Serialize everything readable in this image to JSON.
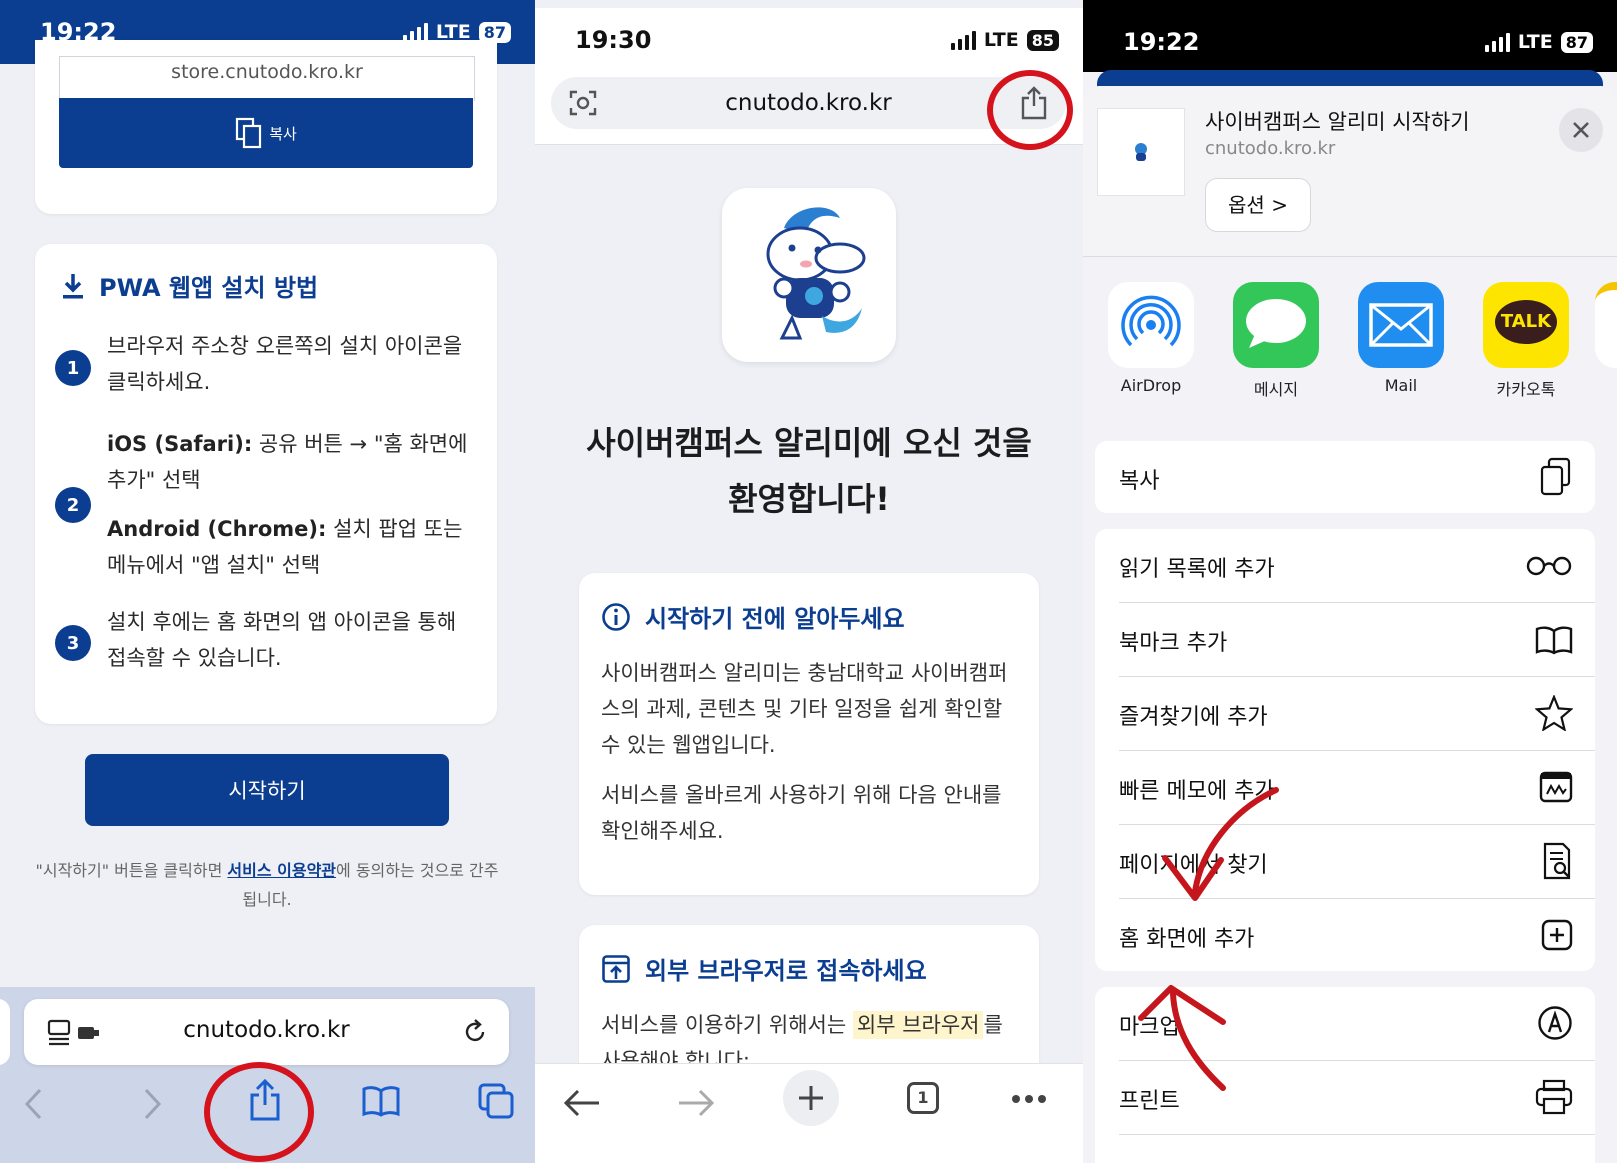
{
  "panel1": {
    "status": {
      "time": "19:22",
      "network": "LTE",
      "battery": "87"
    },
    "store_url": "store.cnutodo.kro.kr",
    "copy_label": "복사",
    "pwa_title": "PWA 웹앱 설치 방법",
    "steps": [
      {
        "num": "1",
        "text": "브라우저 주소창 오른쪽의 설치 아이콘을 클릭하세요."
      },
      {
        "num": "2",
        "ios_label": "iOS (Safari):",
        "ios_text": " 공유 버튼 → \"홈 화면에 추가\" 선택",
        "android_label": "Android (Chrome):",
        "android_text": " 설치 팝업 또는 메뉴에서 \"앱 설치\" 선택"
      },
      {
        "num": "3",
        "text": "설치 후에는 홈 화면의 앱 아이콘을 통해 접속할 수 있습니다."
      }
    ],
    "start_button": "시작하기",
    "terms_prefix": "\"시작하기\" 버튼을 클릭하면 ",
    "terms_link": "서비스 이용약관",
    "terms_suffix": "에 동의하는 것으로 간주됩니다.",
    "address": "cnutodo.kro.kr"
  },
  "panel2": {
    "status": {
      "time": "19:30",
      "network": "LTE",
      "battery": "85"
    },
    "address": "cnutodo.kro.kr",
    "welcome_line1": "사이버캠퍼스 알리미에 오신 것을",
    "welcome_line2": "환영합니다!",
    "notice_title": "시작하기 전에 알아두세요",
    "notice_p1": "사이버캠퍼스 알리미는 충남대학교 사이버캠퍼스의 과제, 콘텐츠 및 기타 일정을 쉽게 확인할 수 있는 웹앱입니다.",
    "notice_p2": "서비스를 올바르게 사용하기 위해 다음 안내를 확인해주세요.",
    "ext_title": "외부 브라우저로 접속하세요",
    "ext_text_prefix": "서비스를 이용하기 위해서는 ",
    "ext_highlight": "외부 브라우저",
    "ext_text_suffix": "를 사용해야 합니다:",
    "tab_count": "1"
  },
  "panel3": {
    "status": {
      "time": "19:22",
      "network": "LTE",
      "battery": "87"
    },
    "share_title": "사이버캠퍼스 알리미 시작하기",
    "share_url": "cnutodo.kro.kr",
    "options_label": "옵션 >",
    "apps": [
      {
        "label": "AirDrop",
        "icon": "airdrop-icon"
      },
      {
        "label": "메시지",
        "icon": "messages-icon"
      },
      {
        "label": "Mail",
        "icon": "mail-icon"
      },
      {
        "label": "카카오톡",
        "icon": "kakaotalk-icon"
      }
    ],
    "kakao_badge": "TALK",
    "copy_label": "복사",
    "actions": [
      {
        "label": "읽기 목록에 추가",
        "icon": "glasses-icon"
      },
      {
        "label": "북마크 추가",
        "icon": "book-icon"
      },
      {
        "label": "즐겨찾기에 추가",
        "icon": "star-icon"
      },
      {
        "label": "빠른 메모에 추가",
        "icon": "quick-note-icon"
      },
      {
        "label": "페이지에서 찾기",
        "icon": "find-in-page-icon"
      },
      {
        "label": "홈 화면에 추가",
        "icon": "add-square-icon"
      }
    ],
    "actions2": [
      {
        "label": "마크업",
        "icon": "markup-icon"
      },
      {
        "label": "프린트",
        "icon": "printer-icon"
      }
    ]
  }
}
